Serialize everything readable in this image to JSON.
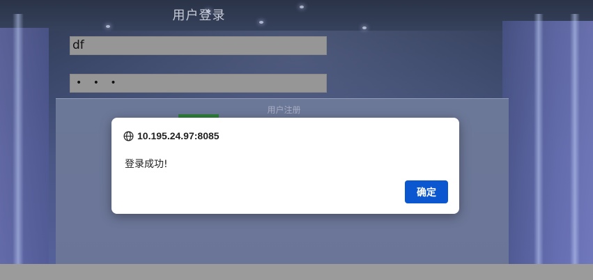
{
  "page": {
    "title": "用户登录",
    "username_value": "df",
    "password_masked": "• • •",
    "register_link": "用户注册"
  },
  "dialog": {
    "origin": "10.195.24.97:8085",
    "message": "登录成功!",
    "ok_label": "确定",
    "accent_color": "#0b57d0"
  },
  "icons": {
    "dialog_origin": "globe-icon"
  }
}
